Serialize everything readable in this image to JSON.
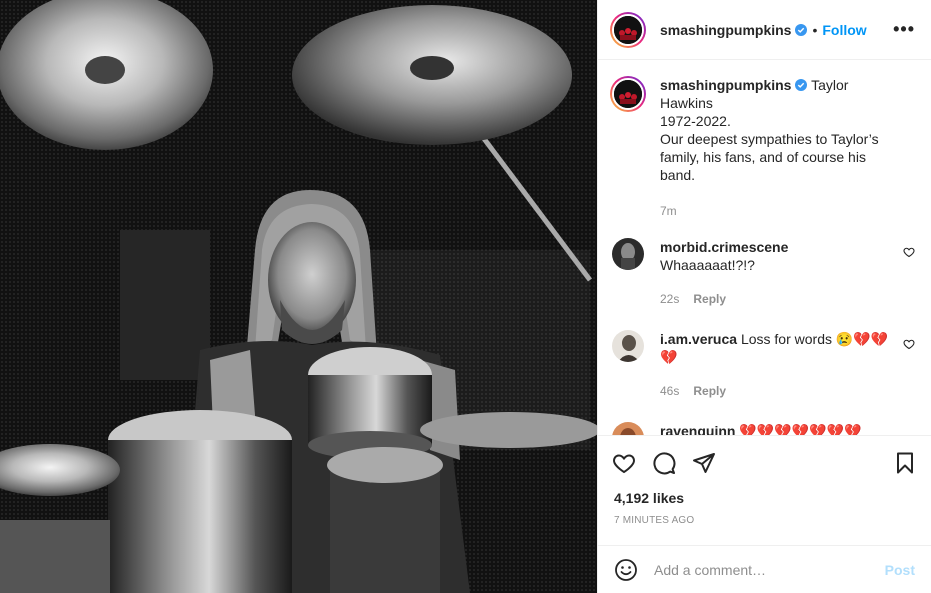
{
  "post": {
    "username": "smashingpumpkins",
    "follow_label": "Follow",
    "separator": "•",
    "more_label": "•••"
  },
  "caption": {
    "username": "smashingpumpkins",
    "text_line1": "Taylor Hawkins",
    "text_rest": "1972-2022.\nOur deepest sympathies to Taylor’s family, his fans, and of course his band.",
    "time": "7m"
  },
  "comments": [
    {
      "username": "morbid.crimescene",
      "text": "Whaaaaaat!?!?",
      "time": "22s",
      "reply": "Reply"
    },
    {
      "username": "i.am.veruca",
      "text": "Loss for words 😢💔💔💔",
      "time": "46s",
      "reply": "Reply"
    },
    {
      "username": "ravenquinn",
      "text": "💔💔💔💔💔💔💔"
    }
  ],
  "likes": "4,192 likes",
  "timestamp": "7 MINUTES AGO",
  "comment_box": {
    "placeholder": "Add a comment…",
    "post_label": "Post"
  },
  "colors": {
    "accent": "#0095f6",
    "post_disabled": "#b2dffc",
    "verified": "#3897f0"
  }
}
